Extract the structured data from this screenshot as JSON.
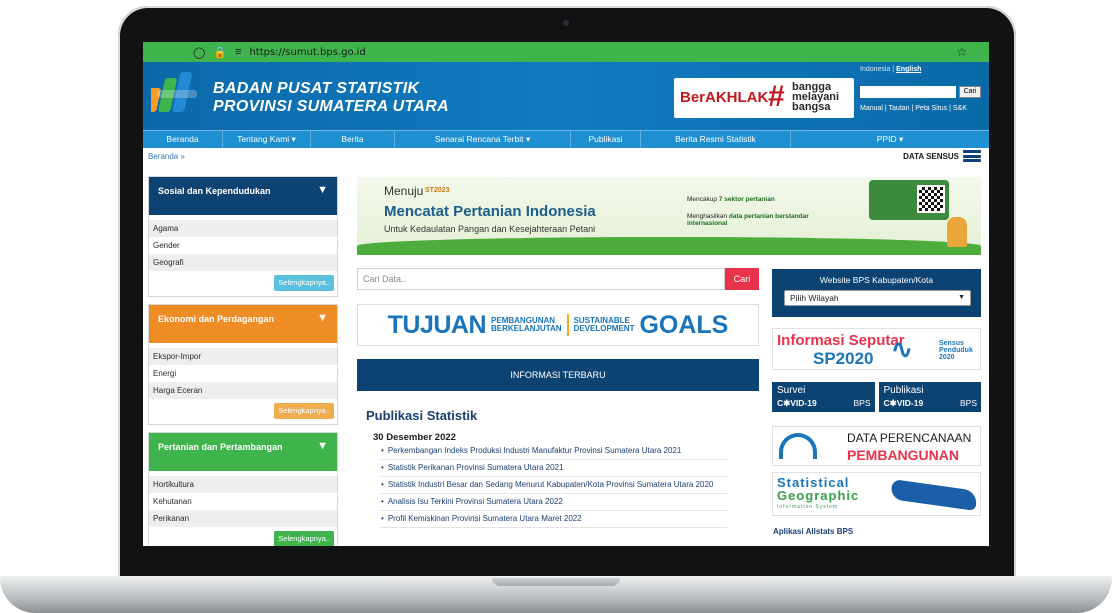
{
  "browser": {
    "url": "https://sumut.bps.go.id"
  },
  "header": {
    "brand_line1": "BADAN PUSAT STATISTIK",
    "brand_line2": "PROVINSI SUMATERA UTARA",
    "lang_indonesia": "Indonesia",
    "lang_sep": " | ",
    "lang_english": "English",
    "search_button": "Cari",
    "links": "Manual | Tautan | Peta Situs | S&K",
    "akhlak_main": "BerAKHLAK",
    "akhlak_tag": "bangga\nmelayani\nbangsa"
  },
  "nav": [
    {
      "label": "Beranda"
    },
    {
      "label": "Tentang Kami ▾"
    },
    {
      "label": "Berita"
    },
    {
      "label": "Senarai Rencana Terbit ▾"
    },
    {
      "label": "Publikasi"
    },
    {
      "label": "Berita Resmi Statistik"
    },
    {
      "label": "PPID ▾"
    }
  ],
  "breadcrumb": "Beranda »",
  "data_sensus": "DATA SENSUS",
  "sidebar": [
    {
      "title": "Sosial dan Kependudukan",
      "color": "#0d4373",
      "items": [
        "Agama",
        "Gender",
        "Geografi"
      ],
      "more": "Selengkapnya..",
      "more_color": "#5bc0de"
    },
    {
      "title": "Ekonomi dan Perdagangan",
      "color": "#ef8c25",
      "items": [
        "Ekspor-Impor",
        "Energi",
        "Harga Eceran"
      ],
      "more": "Selengkapnya..",
      "more_color": "#f0ad4e"
    },
    {
      "title": "Pertanian dan Pertambangan",
      "color": "#3fb44c",
      "items": [
        "Hortikultura",
        "Kehutanan",
        "Perikanan"
      ],
      "more": "Selengkapnya..",
      "more_color": "#3fb44c"
    }
  ],
  "banner": {
    "menuju": "Menuju",
    "st_year": "ST2023",
    "headline": "Mencatat Pertanian Indonesia",
    "sub": "Untuk Kedaulatan Pangan dan Kesejahteraan Petani",
    "c1_pre": "Mencakup ",
    "c1_bold": "7 sektor pertanian",
    "c2_pre": "Menghasilkan ",
    "c2_bold": "data pertanian berstandar internasional"
  },
  "search": {
    "placeholder": "Cari Data..",
    "button": "Cari"
  },
  "sdg": {
    "tujuan": "TUJUAN",
    "pembangunan": "PEMBANGUNAN",
    "berkelanjutan": "BERKELANJUTAN",
    "sustainable": "SUSTAINABLE",
    "development": "DEVELOPMENT",
    "goals": "GOALS"
  },
  "info_header": "INFORMASI TERBARU",
  "publikasi": {
    "heading": "Publikasi Statistik",
    "date": "30 Desember 2022",
    "items": [
      "Perkembangan Indeks Produksi Industri Manufaktur Provinsi Sumatera Utara 2021",
      "Statistik Perikanan Provinsi Sumatera Utara 2021",
      "Statistik Industri Besar dan Sedang Menurut Kabupaten/Kota Provinsi Sumatera Utara 2020",
      "Analisis Isu Terkini Provinsi Sumatera Utara 2022",
      "Profil Kemiskinan Provinsi Sumatera Utara Maret 2022"
    ]
  },
  "right": {
    "kab_title": "Website BPS Kabupaten/Kota",
    "kab_select": "Pilih Wilayah",
    "sp_a": "Informasi Seputar",
    "sp_b": "SP2020",
    "sp_c1": "Sensus",
    "sp_c2": "Penduduk",
    "sp_c3": "2020",
    "survei": "Survei",
    "publikasi": "Publikasi",
    "covid": "C✱VID-19",
    "bps": "BPS",
    "dp1": "DATA PERENCANAAN",
    "dp2": "PEMBANGUNAN",
    "sgis1": "Statistical",
    "sgis2": "Geographic",
    "sgis3": "Information System",
    "allstats": "Aplikasi Allstats BPS"
  }
}
